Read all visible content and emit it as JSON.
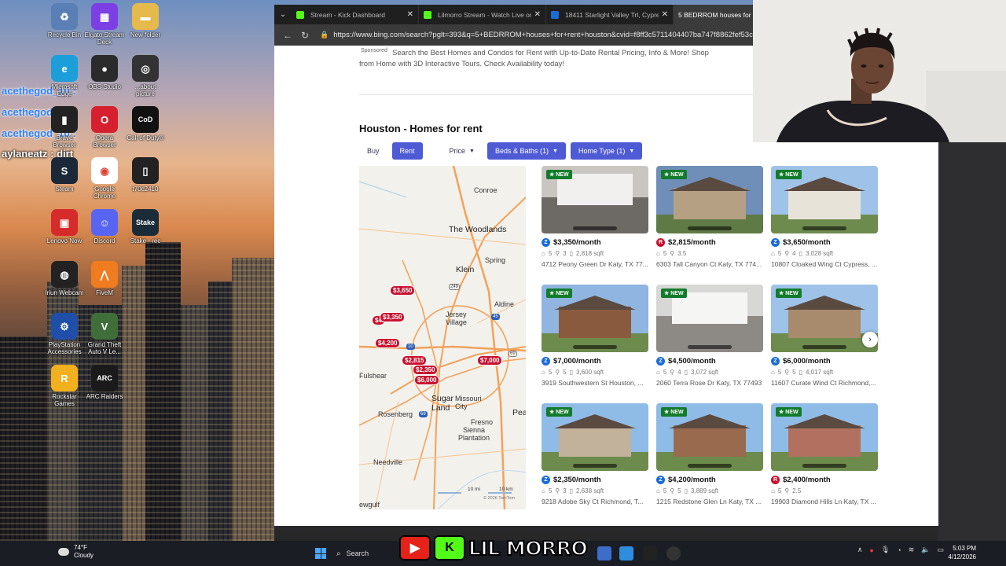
{
  "desktop": {
    "icons": [
      {
        "label": "Recycle Bin",
        "color": "#5a7fb5",
        "glyph": "♻"
      },
      {
        "label": "Elgato Stream Deck",
        "color": "#7b3fe4",
        "glyph": "▦"
      },
      {
        "label": "New folder",
        "color": "#e6b94c",
        "glyph": "▬"
      },
      {
        "label": "Microsoft Edge",
        "color": "#1c9fd8",
        "glyph": "e"
      },
      {
        "label": "OBS Studio",
        "color": "#2b2b2b",
        "glyph": "●"
      },
      {
        "label": "...about picture",
        "color": "#333333",
        "glyph": "◎"
      },
      {
        "label": "Brave Browser",
        "color": "#222222",
        "glyph": "▮"
      },
      {
        "label": "Opera Browser",
        "color": "#d6202f",
        "glyph": "O"
      },
      {
        "label": "Call of Duty®",
        "color": "#111111",
        "glyph": "CoD"
      },
      {
        "label": "Steam",
        "color": "#1b2838",
        "glyph": "S"
      },
      {
        "label": "Google Chrome",
        "color": "#ffffff",
        "glyph": "◉"
      },
      {
        "label": "t70c2410",
        "color": "#222222",
        "glyph": "▯"
      },
      {
        "label": "Lenovo Now",
        "color": "#d62b2b",
        "glyph": "▣"
      },
      {
        "label": "Discord",
        "color": "#5865f2",
        "glyph": "☺"
      },
      {
        "label": "Stake - rec",
        "color": "#1a2c38",
        "glyph": "Stake"
      },
      {
        "label": "Iriun Webcam",
        "color": "#222222",
        "glyph": "◍"
      },
      {
        "label": "FiveM",
        "color": "#f07c20",
        "glyph": "⋀"
      },
      {
        "label": "PlayStation Accessories",
        "color": "#1f4fa8",
        "glyph": "⚙"
      },
      {
        "label": "Grand Theft Auto V Le...",
        "color": "#3f6e3a",
        "glyph": "V"
      },
      {
        "label": "Rockstar Games",
        "color": "#f2b01e",
        "glyph": "R"
      },
      {
        "label": "ARC Raiders",
        "color": "#1a1a1a",
        "glyph": "ARC"
      }
    ],
    "chat": [
      {
        "text": "acethegod_10 :",
        "style": "blue"
      },
      {
        "text": "acethegod_10 :",
        "style": "blue"
      },
      {
        "text": "acethegod_10 :",
        "style": "blue"
      },
      {
        "text": "aylaneatz : dirt",
        "style": "white"
      }
    ]
  },
  "browser": {
    "tabs": [
      {
        "title": "Stream - Kick Dashboard",
        "favicon_color": "#53fc18",
        "active": false
      },
      {
        "title": "Lilmorro Stream - Watch Live on Kick",
        "favicon_color": "#53fc18",
        "active": false
      },
      {
        "title": "18411 Starlight Valley Trl, Cypress, TX",
        "favicon_color": "#1a6cd8",
        "active": false
      },
      {
        "title": "5 BEDRROM houses for rent houston",
        "favicon_color": "#2b7de9",
        "active": true
      }
    ],
    "url": "https://www.bing.com/search?pglt=393&q=5+BEDRROM+houses+for+rent+houston&cvid=f8ff3c5711404407ba747f8862fef53c"
  },
  "page": {
    "sponsored_label": "Sponsored",
    "ad_text": "Search the Best Homes and Condos for Rent with Up-to-Date Rental Pricing, Info & More! Shop from Home with 3D Interactive Tours. Check Availability today!",
    "section_title": "Houston - Homes for rent",
    "filters": {
      "buy": "Buy",
      "rent": "Rent",
      "price": "Price",
      "beds_baths": "Beds & Baths (1)",
      "home_type": "Home Type (1)"
    },
    "map": {
      "labels": [
        {
          "text": "Conroe",
          "kind": "small"
        },
        {
          "text": "The Woodlands",
          "kind": "big"
        },
        {
          "text": "Spring",
          "kind": "small"
        },
        {
          "text": "Klein",
          "kind": "big"
        },
        {
          "text": "Aldine",
          "kind": "small"
        },
        {
          "text": "Jersey Village",
          "kind": "small"
        },
        {
          "text": "Fulshear",
          "kind": "small"
        },
        {
          "text": "Sugar Land",
          "kind": "big"
        },
        {
          "text": "Missouri City",
          "kind": "small"
        },
        {
          "text": "Rosenberg",
          "kind": "small"
        },
        {
          "text": "Fresno",
          "kind": "small"
        },
        {
          "text": "Sienna Plantation",
          "kind": "small"
        },
        {
          "text": "Pea",
          "kind": "big"
        },
        {
          "text": "Needville",
          "kind": "small"
        },
        {
          "text": "ewgulf",
          "kind": "small"
        }
      ],
      "pins": [
        "$3,650",
        "$4",
        "$3,350",
        "$4,200",
        "$2,815",
        "$2,350",
        "$6,000",
        "$7,000"
      ],
      "scale": {
        "miles": "10 mi",
        "km": "10 km",
        "copyright": "© 2026 TomTom"
      }
    },
    "listings": [
      {
        "price": "$3,350/month",
        "source": "z",
        "beds": "5",
        "baths": "3",
        "sqft": "2,818 sqft",
        "address": "4712 Peony Green Dr Katy, TX 77...",
        "tag": "NEW"
      },
      {
        "price": "$2,815/month",
        "source": "r",
        "beds": "5",
        "baths": "3.5",
        "sqft": "",
        "address": "6303 Tall Canyon Ct Katy, TX 774...",
        "tag": "NEW"
      },
      {
        "price": "$3,650/month",
        "source": "z",
        "beds": "5",
        "baths": "4",
        "sqft": "3,028 sqft",
        "address": "10807 Cloaked Wing Ct Cypress, ...",
        "tag": "NEW"
      },
      {
        "price": "$7,000/month",
        "source": "z",
        "beds": "5",
        "baths": "5",
        "sqft": "3,600 sqft",
        "address": "3919 Southwestern St Houston, ...",
        "tag": "NEW"
      },
      {
        "price": "$4,500/month",
        "source": "z",
        "beds": "5",
        "baths": "4",
        "sqft": "3,072 sqft",
        "address": "2060 Terra Rose Dr Katy, TX 77493",
        "tag": "NEW"
      },
      {
        "price": "$6,000/month",
        "source": "z",
        "beds": "5",
        "baths": "5",
        "sqft": "4,017 sqft",
        "address": "11607 Curate Wind Ct Richmond,...",
        "tag": "NEW"
      },
      {
        "price": "$2,350/month",
        "source": "z",
        "beds": "5",
        "baths": "3",
        "sqft": "2,638 sqft",
        "address": "9218 Adobe Sky Ct Richmond, T...",
        "tag": "NEW"
      },
      {
        "price": "$4,200/month",
        "source": "z",
        "beds": "5",
        "baths": "5",
        "sqft": "3,889 sqft",
        "address": "1215 Redstone Glen Ln Katy, TX ...",
        "tag": "NEW"
      },
      {
        "price": "$2,400/month",
        "source": "r",
        "beds": "5",
        "baths": "2.5",
        "sqft": "",
        "address": "19903 Diamond Hills Ln Katy, TX ...",
        "tag": "NEW"
      }
    ],
    "next_icon": "chevron-right-icon"
  },
  "taskbar": {
    "weather_temp": "74°F",
    "weather_desc": "Cloudy",
    "search_label": "Search",
    "brand_text": "LIL MORRO",
    "time": "5:03 PM",
    "date": "4/12/2026"
  }
}
